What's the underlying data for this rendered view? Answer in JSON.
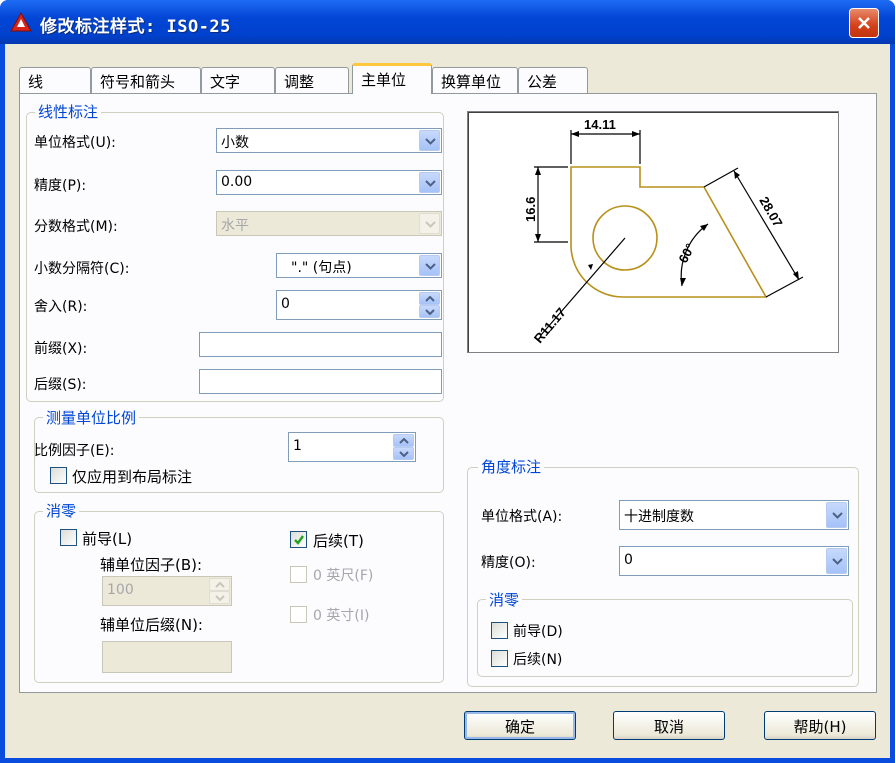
{
  "window": {
    "title": "修改标注样式: ISO-25"
  },
  "tabs": [
    "线",
    "符号和箭头",
    "文字",
    "调整",
    "主单位",
    "换算单位",
    "公差"
  ],
  "linear": {
    "legend": "线性标注",
    "unit_format_label": "单位格式(U):",
    "unit_format_value": "小数",
    "precision_label": "精度(P):",
    "precision_value": "0.00",
    "fraction_format_label": "分数格式(M):",
    "fraction_format_value": "水平",
    "decimal_sep_label": "小数分隔符(C):",
    "decimal_sep_value": "\".\"   (句点)",
    "round_label": "舍入(R):",
    "round_value": "0",
    "prefix_label": "前缀(X):",
    "prefix_value": "",
    "suffix_label": "后缀(S):",
    "suffix_value": ""
  },
  "scale": {
    "legend": "测量单位比例",
    "factor_label": "比例因子(E):",
    "factor_value": "1",
    "layout_only_label": "仅应用到布局标注",
    "layout_only_checked": false
  },
  "zero_linear": {
    "legend": "消零",
    "leading_label": "前导(L)",
    "leading_checked": false,
    "sub_factor_label": "辅单位因子(B):",
    "sub_factor_value": "100",
    "sub_suffix_label": "辅单位后缀(N):",
    "sub_suffix_value": "",
    "trailing_label": "后续(T)",
    "trailing_checked": true,
    "feet_label": "0 英尺(F)",
    "inches_label": "0 英寸(I)"
  },
  "preview": {
    "dim_top": "14.11",
    "dim_left": "16.6",
    "dim_right": "28.07",
    "dim_angle": "60°",
    "dim_radius": "R11.17"
  },
  "angular": {
    "legend": "角度标注",
    "unit_format_label": "单位格式(A):",
    "unit_format_value": "十进制度数",
    "precision_label": "精度(O):",
    "precision_value": "0"
  },
  "zero_angular": {
    "legend": "消零",
    "leading_label": "前导(D)",
    "trailing_label": "后续(N)"
  },
  "buttons": {
    "ok": "确定",
    "cancel": "取消",
    "help": "帮助(H)"
  },
  "colors": {
    "title_blue": "#0041cd",
    "legend_blue": "#0046d5",
    "preview_line": "#b8901a"
  }
}
